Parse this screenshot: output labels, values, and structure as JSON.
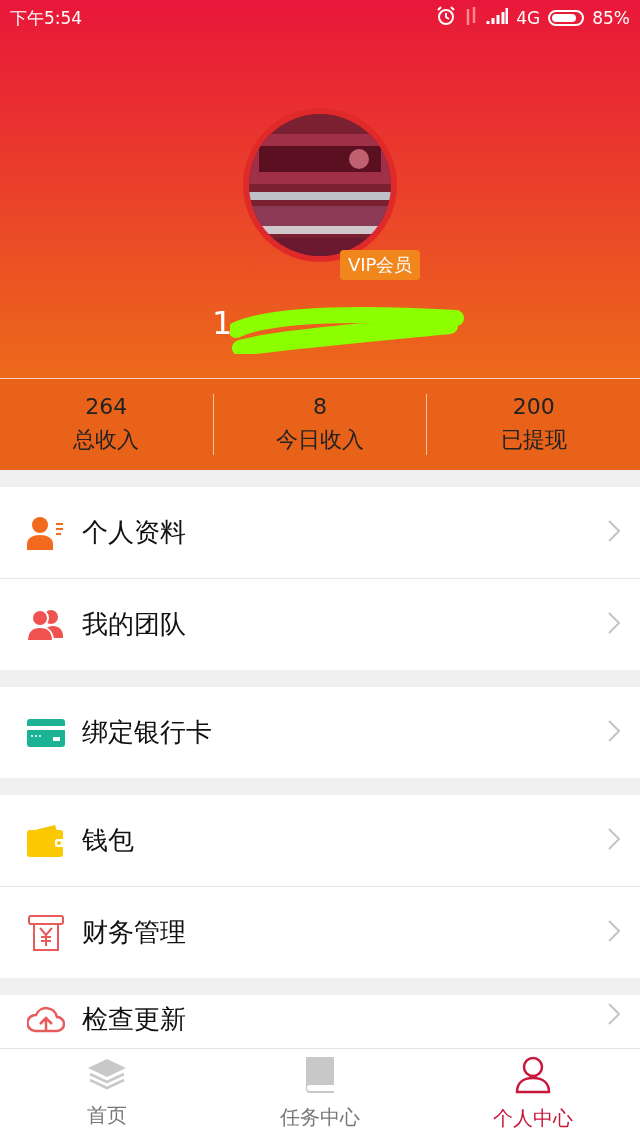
{
  "status_bar": {
    "time": "下午5:54",
    "network": "4G",
    "battery": "85%"
  },
  "profile": {
    "badge": "VIP会员",
    "username": "1"
  },
  "stats": [
    {
      "value": "264",
      "label": "总收入"
    },
    {
      "value": "8",
      "label": "今日收入"
    },
    {
      "value": "200",
      "label": "已提现"
    }
  ],
  "menu_groups": [
    {
      "items": [
        {
          "kind": "profile",
          "label": "个人资料"
        },
        {
          "kind": "team",
          "label": "我的团队"
        }
      ]
    },
    {
      "items": [
        {
          "kind": "card",
          "label": "绑定银行卡"
        }
      ]
    },
    {
      "items": [
        {
          "kind": "wallet",
          "label": "钱包"
        },
        {
          "kind": "finance",
          "label": "财务管理"
        }
      ]
    },
    {
      "items": [
        {
          "kind": "update",
          "label": "检查更新"
        }
      ]
    }
  ],
  "tab_bar": [
    {
      "kind": "home",
      "label": "首页",
      "selected": false
    },
    {
      "kind": "tasks",
      "label": "任务中心",
      "selected": false
    },
    {
      "kind": "me",
      "label": "个人中心",
      "selected": true
    }
  ]
}
